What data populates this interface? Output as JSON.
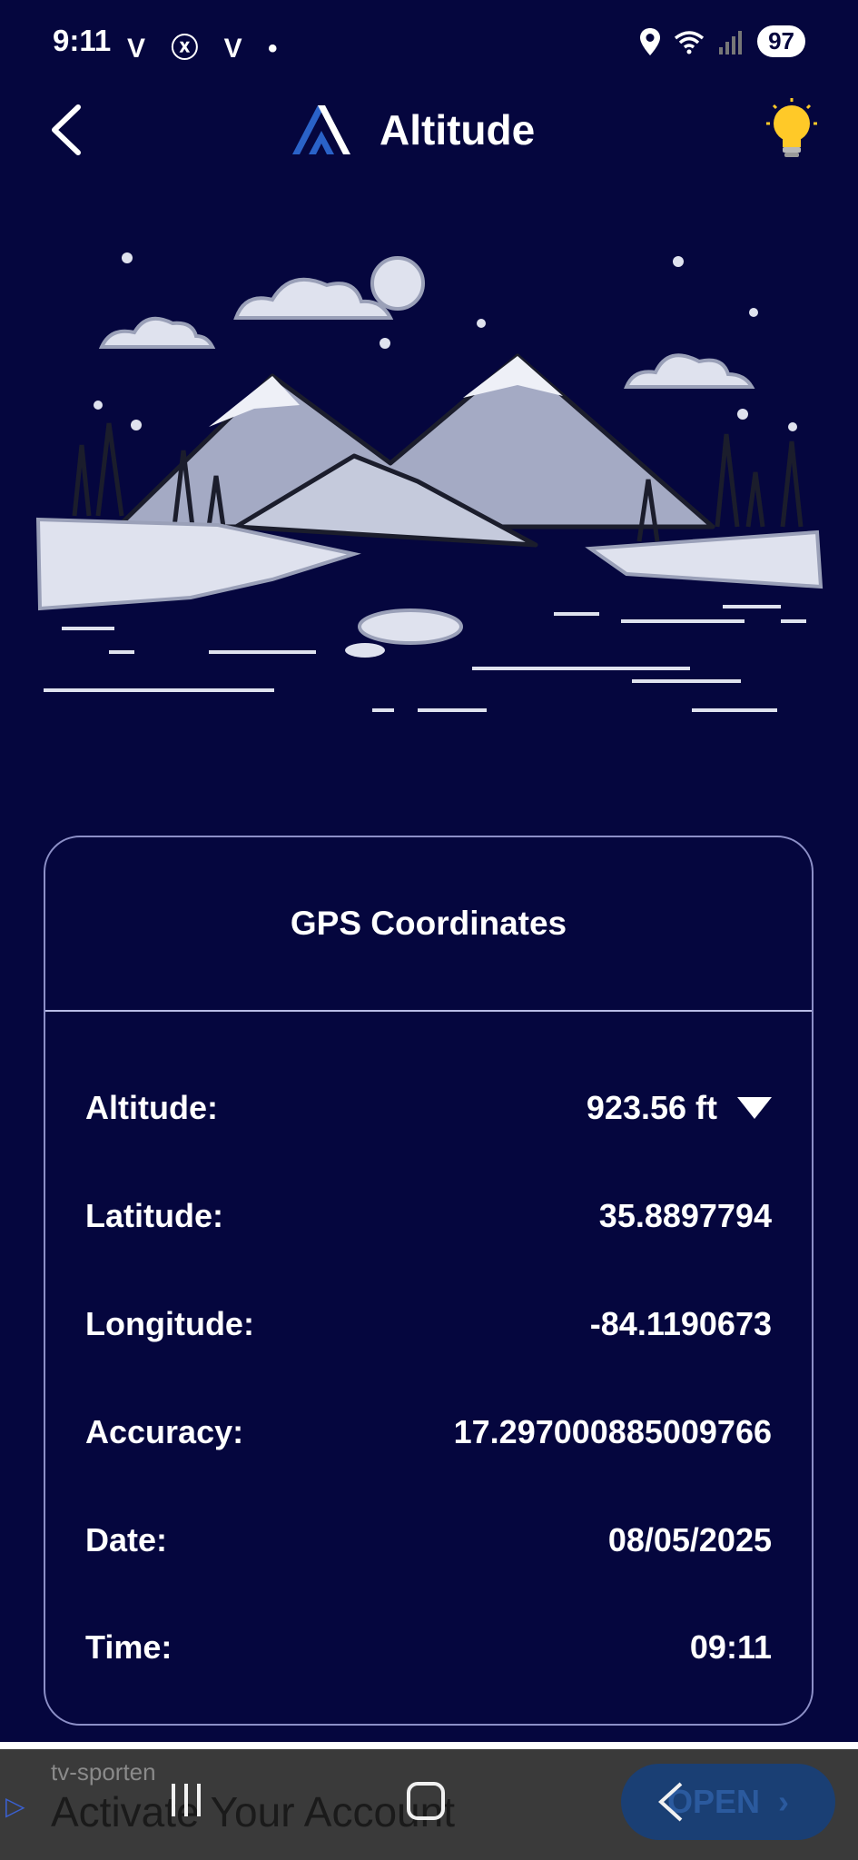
{
  "status_bar": {
    "time": "9:11",
    "left_icons": "V ⓧ V •",
    "battery": "97"
  },
  "header": {
    "title": "Altitude",
    "icons": {
      "back": "back-arrow-icon",
      "logo": "app-logo-icon",
      "tip": "lightbulb-icon"
    }
  },
  "card": {
    "title": "GPS Coordinates",
    "rows": [
      {
        "label": "Altitude:",
        "value": "923.56 ft"
      },
      {
        "label": "Latitude:",
        "value": "35.8897794"
      },
      {
        "label": "Longitude:",
        "value": "-84.1190673"
      },
      {
        "label": "Accuracy:",
        "value": "17.297000885009766"
      },
      {
        "label": "Date:",
        "value": "08/05/2025"
      },
      {
        "label": "Time:",
        "value": "09:11"
      }
    ]
  },
  "ad": {
    "sponsor": "tv-sporten",
    "headline": "Activate Your Account",
    "button_label": "OPEN"
  },
  "colors": {
    "background": "#05063e",
    "card_border": "#8c8fc7",
    "ad_button": "#1a3f74"
  }
}
